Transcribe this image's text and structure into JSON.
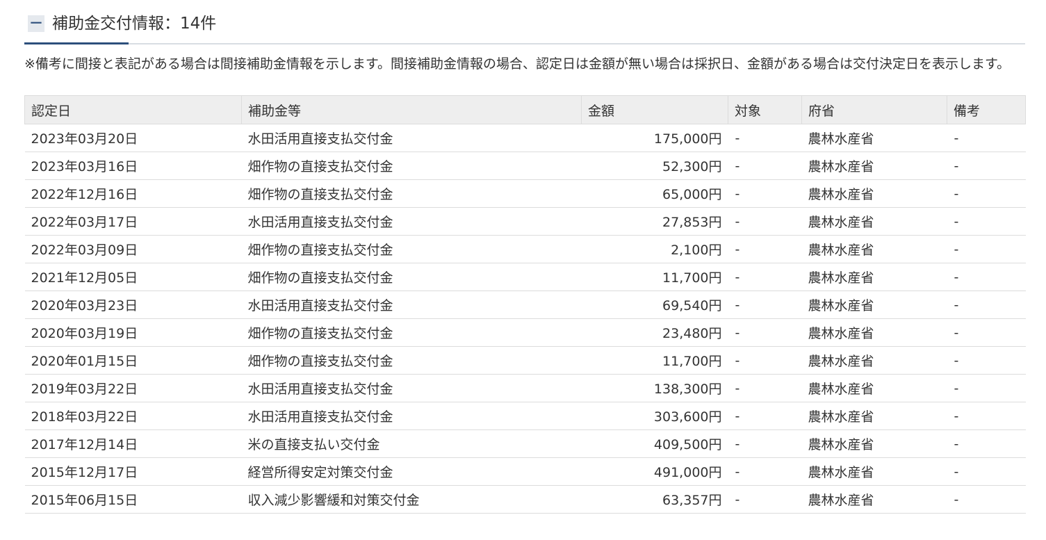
{
  "section": {
    "toggle_symbol": "－",
    "title": "補助金交付情報：14件"
  },
  "note": "※備考に間接と表記がある場合は間接補助金情報を示します。間接補助金情報の場合、認定日は金額が無い場合は採択日、金額がある場合は交付決定日を表示します。",
  "table": {
    "headers": [
      "認定日",
      "補助金等",
      "金額",
      "対象",
      "府省",
      "備考"
    ],
    "rows": [
      {
        "date": "2023年03月20日",
        "subsidy": "水田活用直接支払交付金",
        "amount": "175,000円",
        "target": "-",
        "ministry": "農林水産省",
        "remarks": "-"
      },
      {
        "date": "2023年03月16日",
        "subsidy": "畑作物の直接支払交付金",
        "amount": "52,300円",
        "target": "-",
        "ministry": "農林水産省",
        "remarks": "-"
      },
      {
        "date": "2022年12月16日",
        "subsidy": "畑作物の直接支払交付金",
        "amount": "65,000円",
        "target": "-",
        "ministry": "農林水産省",
        "remarks": "-"
      },
      {
        "date": "2022年03月17日",
        "subsidy": "水田活用直接支払交付金",
        "amount": "27,853円",
        "target": "-",
        "ministry": "農林水産省",
        "remarks": "-"
      },
      {
        "date": "2022年03月09日",
        "subsidy": "畑作物の直接支払交付金",
        "amount": "2,100円",
        "target": "-",
        "ministry": "農林水産省",
        "remarks": "-"
      },
      {
        "date": "2021年12月05日",
        "subsidy": "畑作物の直接支払交付金",
        "amount": "11,700円",
        "target": "-",
        "ministry": "農林水産省",
        "remarks": "-"
      },
      {
        "date": "2020年03月23日",
        "subsidy": "水田活用直接支払交付金",
        "amount": "69,540円",
        "target": "-",
        "ministry": "農林水産省",
        "remarks": "-"
      },
      {
        "date": "2020年03月19日",
        "subsidy": "畑作物の直接支払交付金",
        "amount": "23,480円",
        "target": "-",
        "ministry": "農林水産省",
        "remarks": "-"
      },
      {
        "date": "2020年01月15日",
        "subsidy": "畑作物の直接支払交付金",
        "amount": "11,700円",
        "target": "-",
        "ministry": "農林水産省",
        "remarks": "-"
      },
      {
        "date": "2019年03月22日",
        "subsidy": "水田活用直接支払交付金",
        "amount": "138,300円",
        "target": "-",
        "ministry": "農林水産省",
        "remarks": "-"
      },
      {
        "date": "2018年03月22日",
        "subsidy": "水田活用直接支払交付金",
        "amount": "303,600円",
        "target": "-",
        "ministry": "農林水産省",
        "remarks": "-"
      },
      {
        "date": "2017年12月14日",
        "subsidy": "米の直接支払い交付金",
        "amount": "409,500円",
        "target": "-",
        "ministry": "農林水産省",
        "remarks": "-"
      },
      {
        "date": "2015年12月17日",
        "subsidy": "経営所得安定対策交付金",
        "amount": "491,000円",
        "target": "-",
        "ministry": "農林水産省",
        "remarks": "-"
      },
      {
        "date": "2015年06月15日",
        "subsidy": "収入減少影響緩和対策交付金",
        "amount": "63,357円",
        "target": "-",
        "ministry": "農林水産省",
        "remarks": "-"
      }
    ]
  },
  "colors": {
    "accent": "#2d4f7c",
    "header_bg": "#eeeeee",
    "border": "#dcdcdc"
  }
}
